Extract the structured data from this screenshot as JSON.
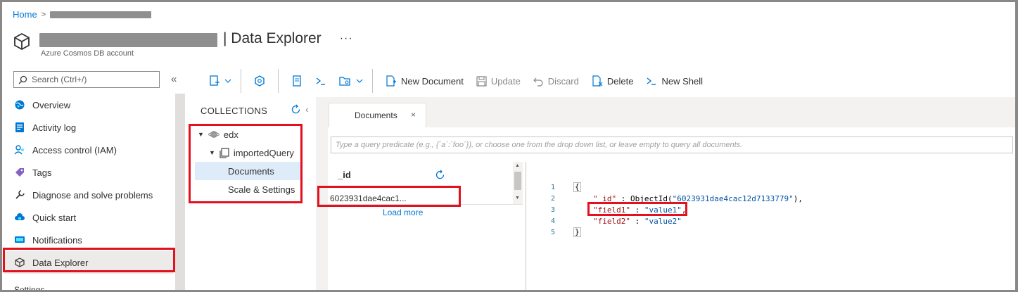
{
  "breadcrumb": {
    "home": "Home",
    "separator": ">"
  },
  "header": {
    "title": "| Data Explorer",
    "subtitle": "Azure Cosmos DB account",
    "more": "···"
  },
  "search": {
    "placeholder": "Search (Ctrl+/)"
  },
  "nav": {
    "collapse": "«",
    "items": [
      {
        "label": "Overview",
        "icon": "globe-icon"
      },
      {
        "label": "Activity log",
        "icon": "activity-log-icon"
      },
      {
        "label": "Access control (IAM)",
        "icon": "people-icon"
      },
      {
        "label": "Tags",
        "icon": "tag-icon"
      },
      {
        "label": "Diagnose and solve problems",
        "icon": "wrench-icon"
      },
      {
        "label": "Quick start",
        "icon": "cloud-icon"
      },
      {
        "label": "Notifications",
        "icon": "notification-icon"
      },
      {
        "label": "Data Explorer",
        "icon": "cube-icon"
      }
    ],
    "section": "Settings"
  },
  "toolbar": {
    "new_document": "New Document",
    "update": "Update",
    "discard": "Discard",
    "delete": "Delete",
    "new_shell": "New Shell"
  },
  "collections": {
    "header": "COLLECTIONS",
    "database": "edx",
    "collection": "importedQuery",
    "documents": "Documents",
    "scale_settings": "Scale & Settings"
  },
  "tab": {
    "label": "Documents",
    "close": "×"
  },
  "query": {
    "placeholder": "Type a query predicate (e.g., {´a´:´foo´}), or choose one from the drop down list, or leave empty to query all documents."
  },
  "documents_list": {
    "header": "_id",
    "rows": [
      "6023931dae4cac1..."
    ],
    "load_more": "Load more"
  },
  "editor": {
    "line_numbers": [
      "1",
      "2",
      "3",
      "4",
      "5"
    ],
    "open_brace": "{",
    "close_brace": "}",
    "id_key": "\"_id\"",
    "id_sep": " : ",
    "id_value": "ObjectId(\"6023931dae4cac12d7133779\"),",
    "field1_key": "\"field1\"",
    "field1_sep": " : ",
    "field1_value": "\"value1\"",
    "field1_comma": ",",
    "field2_key": "\"field2\"",
    "field2_sep": " : ",
    "field2_value": "\"value2\""
  },
  "colors": {
    "accent": "#0078d4",
    "annotation": "#e3101d",
    "selected": "#deecf9"
  }
}
